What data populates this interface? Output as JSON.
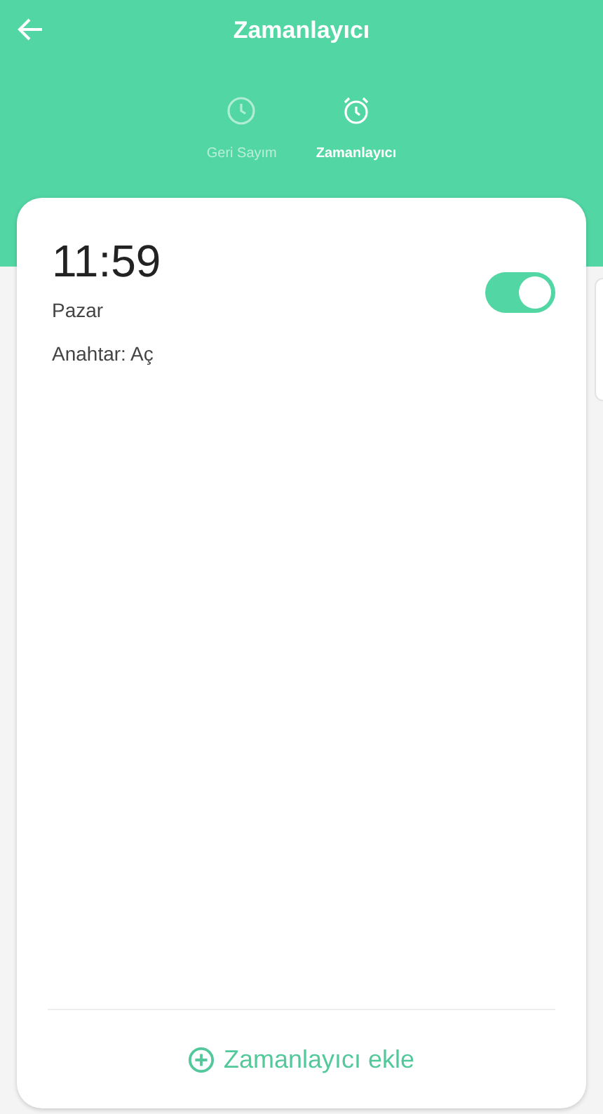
{
  "header": {
    "title": "Zamanlayıcı"
  },
  "tabs": [
    {
      "label": "Geri Sayım",
      "kind": "clock",
      "selected": false
    },
    {
      "label": "Zamanlayıcı",
      "kind": "alarm",
      "selected": true
    }
  ],
  "timers": [
    {
      "time": "11:59",
      "days": "Pazar",
      "action": "Anahtar: Aç",
      "on": true
    }
  ],
  "add_button": {
    "label": "Zamanlayıcı ekle"
  }
}
